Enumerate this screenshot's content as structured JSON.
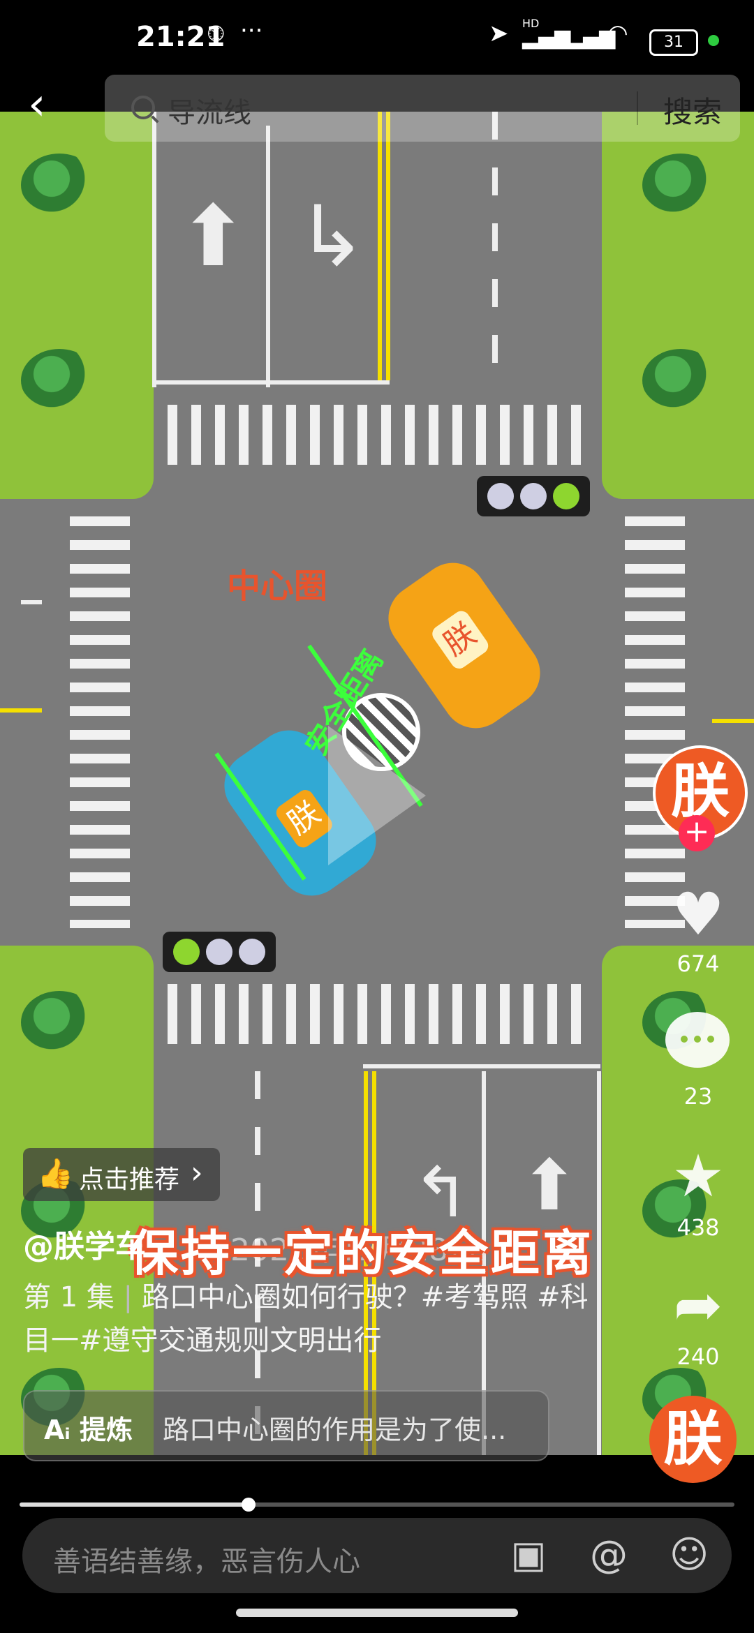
{
  "status_bar": {
    "time": "21:21",
    "dots": "···",
    "battery": "31",
    "signal": "HD"
  },
  "search": {
    "query": "导流线",
    "button": "搜索"
  },
  "video": {
    "center_label": "中心圈",
    "safe_distance_label": "安全距离",
    "subtitle": "保持一定的安全距离",
    "car_badge": "朕",
    "date_overlay": "2022年12月28日"
  },
  "right_rail": {
    "avatar_char": "朕",
    "like_count": "674",
    "comment_count": "23",
    "favorite_count": "438",
    "share_count": "240",
    "music_char": "朕"
  },
  "info": {
    "recommend": "点击推荐",
    "author": "@朕学车",
    "episode": "第 1 集",
    "title": "路口中心圈如何行驶？#考驾照 #科目一#遵守交通规则文明出行",
    "refine_label": "提炼",
    "refine_text": "路口中心圈的作用是为了使..."
  },
  "progress": {
    "fraction": 0.32
  },
  "comment": {
    "placeholder": "善语结善缘，恶言伤人心"
  },
  "colors": {
    "accent": "#e8542d",
    "like_red": "#fe2c55",
    "grass": "#8fc23a"
  }
}
